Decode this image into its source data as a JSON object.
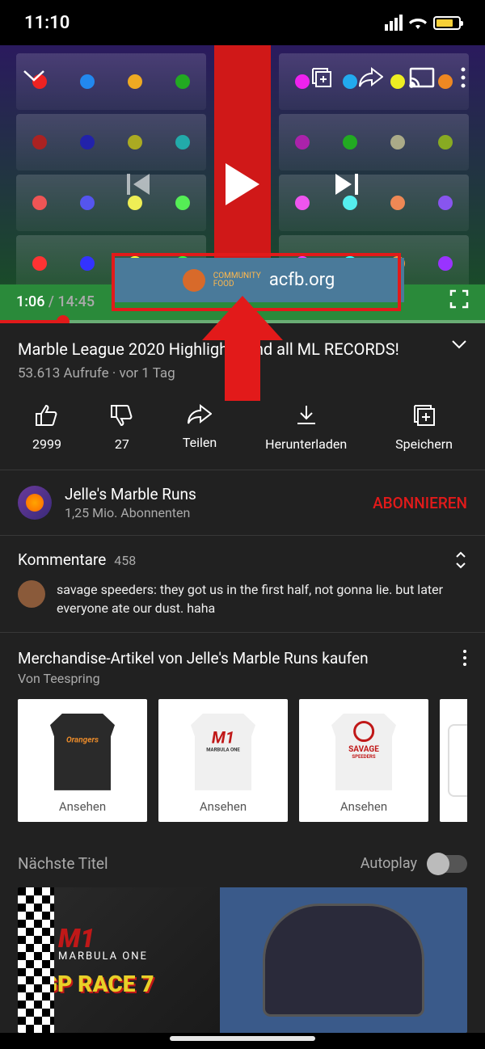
{
  "status": {
    "time": "11:10"
  },
  "player": {
    "current_time": "1:06",
    "duration": "14:45",
    "banner_text": "acfb.org",
    "banner_sub1": "COMMUNITY",
    "banner_sub2": "FOOD"
  },
  "video": {
    "title": "Marble League 2020 Highlights and all ML RECORDS!",
    "views": "53.613 Aufrufe",
    "age": "vor 1 Tag"
  },
  "actions": {
    "likes": "2999",
    "dislikes": "27",
    "share": "Teilen",
    "download": "Herunterladen",
    "save": "Speichern"
  },
  "channel": {
    "name": "Jelle's Marble Runs",
    "subs": "1,25 Mio. Abonnenten",
    "subscribe_label": "ABONNIEREN"
  },
  "comments": {
    "label": "Kommentare",
    "count": "458",
    "top": "savage speeders: they got us in the first half, not gonna lie. but later everyone ate our dust. haha"
  },
  "merch": {
    "title": "Merchandise-Artikel von Jelle's Marble Runs kaufen",
    "sub": "Von Teespring",
    "view_label": "Ansehen",
    "items": [
      {
        "logo_text": "Orangers",
        "logo_color": "#e88a2a",
        "shirt": "dark"
      },
      {
        "logo_text": "M1",
        "sub_text": "MARBULA ONE",
        "logo_color": "#c01818",
        "shirt": "white"
      },
      {
        "logo_text": "SAVAGE",
        "sub_text": "SPEEDERS",
        "logo_color": "#c01818",
        "shirt": "white"
      }
    ]
  },
  "upnext": {
    "label": "Nächste Titel",
    "autoplay_label": "Autoplay",
    "next_brand": "M1",
    "next_brand_sub": "MARBULA ONE",
    "next_title": "GP RACE 7"
  }
}
